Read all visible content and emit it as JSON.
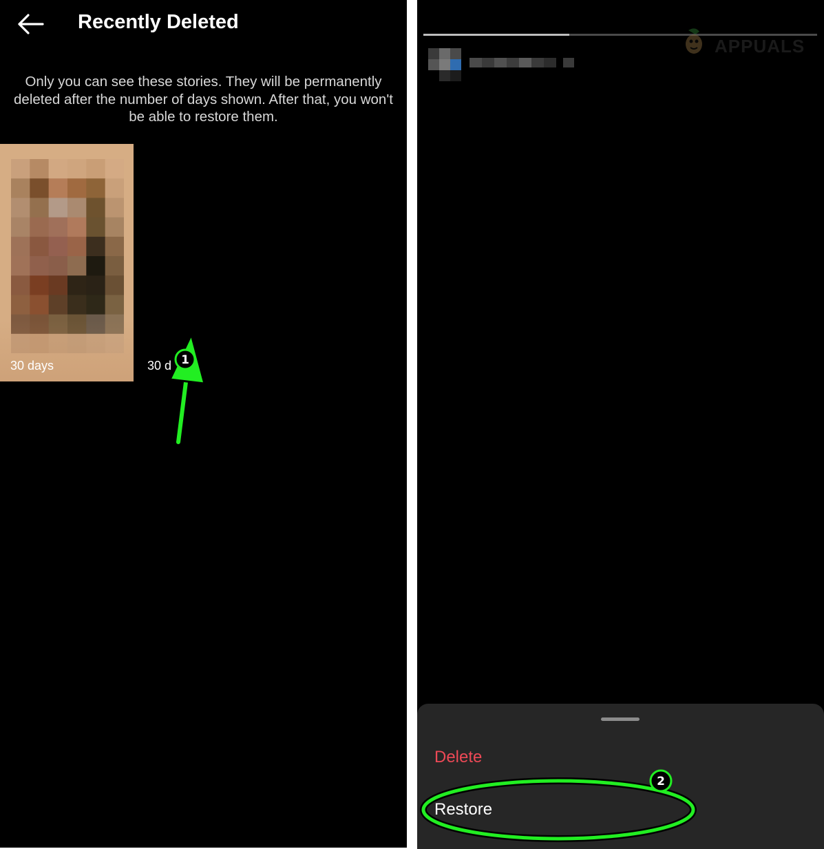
{
  "left_screen": {
    "header": {
      "title": "Recently Deleted",
      "back_icon": "arrow-left-icon"
    },
    "info_text": "Only you can see these stories. They will be permanently deleted after the number of days shown. After that, you won't be able to restore them.",
    "stories": [
      {
        "days_label": "30 days"
      },
      {
        "days_label": "30 d"
      }
    ]
  },
  "right_screen": {
    "progress": 0.37,
    "watermark_icon": "appuals-mascot-icon",
    "watermark_text": "APPUALS",
    "bottom_sheet": {
      "delete_label": "Delete",
      "restore_label": "Restore"
    }
  },
  "annotations": {
    "step_1": "1",
    "step_2": "2",
    "color": "#22ee22"
  }
}
